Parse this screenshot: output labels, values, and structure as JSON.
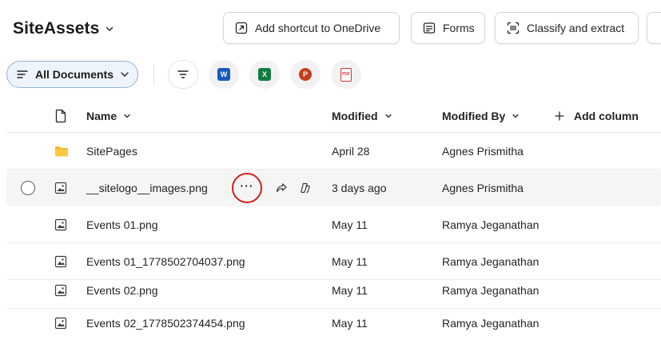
{
  "header": {
    "library_title": "SiteAssets",
    "commands": [
      {
        "id": "shortcut",
        "label": "Add shortcut to OneDrive",
        "icon": "shortcut-arrow-icon"
      },
      {
        "id": "forms",
        "label": "Forms",
        "icon": "forms-icon"
      },
      {
        "id": "classify",
        "label": "Classify and extract",
        "icon": "scan-icon"
      }
    ]
  },
  "viewbar": {
    "view_label": "All Documents",
    "filter_icon": "filter-icon",
    "new_doc_types": [
      {
        "name": "word-icon",
        "letter": "W",
        "color": "#185abd"
      },
      {
        "name": "excel-icon",
        "letter": "X",
        "color": "#107c41"
      },
      {
        "name": "powerpoint-icon",
        "letter": "P",
        "color": "#c43e1c"
      },
      {
        "name": "pdf-icon",
        "letter": "PDF",
        "color": "#d13438"
      }
    ]
  },
  "table": {
    "columns": {
      "name": "Name",
      "modified": "Modified",
      "modified_by": "Modified By",
      "add_column": "Add column"
    },
    "rows": [
      {
        "type": "folder",
        "name": "SitePages",
        "modified": "April 28",
        "modified_by": "Agnes Prismitha",
        "selected": false
      },
      {
        "type": "image",
        "name": "__sitelogo__images.png",
        "modified": "3 days ago",
        "modified_by": "Agnes Prismitha",
        "selected": true
      },
      {
        "type": "image",
        "name": "Events 01.png",
        "modified": "May 11",
        "modified_by": "Ramya Jeganathan",
        "selected": false
      },
      {
        "type": "image",
        "name": "Events 01_1778502704037.png",
        "modified": "May 11",
        "modified_by": "Ramya Jeganathan",
        "selected": false
      },
      {
        "type": "image",
        "name": "Events 02.png",
        "modified": "May 11",
        "modified_by": "Ramya Jeganathan",
        "selected": false
      },
      {
        "type": "image",
        "name": "Events 02_1778502374454.png",
        "modified": "May 11",
        "modified_by": "Ramya Jeganathan",
        "selected": false
      }
    ],
    "row_actions": {
      "more_label": "···",
      "highlight_color": "#d11f1f"
    }
  },
  "colors": {
    "accent": "#0f6cbd",
    "folder": "#f5b731",
    "selected_row": "#f5f5f5"
  }
}
